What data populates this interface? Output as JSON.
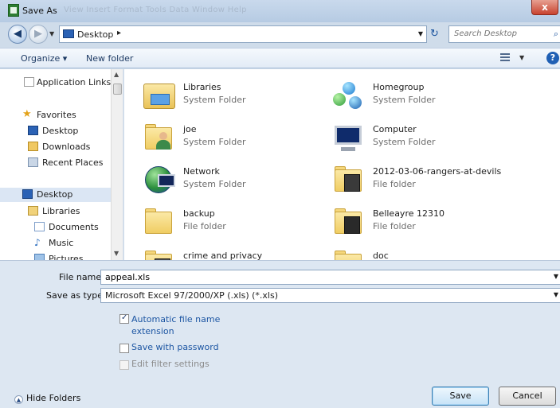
{
  "window": {
    "title": "Save As",
    "ghost_menu": "View   Insert   Format   Tools   Data   Window   Help",
    "close_glyph": "x"
  },
  "address": {
    "path": "Desktop",
    "separator": "▸",
    "search_placeholder": "Search Desktop"
  },
  "toolbar": {
    "organize": "Organize ▾",
    "new_folder": "New folder"
  },
  "navpane": {
    "items": [
      {
        "label": "Application Links",
        "icon": "document-icon"
      },
      {
        "label": "Favorites",
        "icon": "star-icon"
      },
      {
        "label": "Desktop",
        "icon": "desktop-icon"
      },
      {
        "label": "Downloads",
        "icon": "downloads-icon"
      },
      {
        "label": "Recent Places",
        "icon": "recent-places-icon"
      },
      {
        "label": "Desktop",
        "icon": "desktop-icon",
        "selected": true
      },
      {
        "label": "Libraries",
        "icon": "libraries-icon"
      },
      {
        "label": "Documents",
        "icon": "documents-icon"
      },
      {
        "label": "Music",
        "icon": "music-icon"
      },
      {
        "label": "Pictures",
        "icon": "pictures-icon"
      }
    ]
  },
  "files": [
    {
      "name": "Libraries",
      "type": "System Folder",
      "icon": "libraries-icon"
    },
    {
      "name": "Homegroup",
      "type": "System Folder",
      "icon": "homegroup-icon"
    },
    {
      "name": "joe",
      "type": "System Folder",
      "icon": "user-folder-icon"
    },
    {
      "name": "Computer",
      "type": "System Folder",
      "icon": "computer-icon"
    },
    {
      "name": "Network",
      "type": "System Folder",
      "icon": "network-icon"
    },
    {
      "name": "2012-03-06-rangers-at-devils",
      "type": "File folder",
      "icon": "photo-folder-icon"
    },
    {
      "name": "backup",
      "type": "File folder",
      "icon": "folder-icon"
    },
    {
      "name": "Belleayre 12310",
      "type": "File folder",
      "icon": "photo-folder-icon"
    },
    {
      "name": "crime and privacy",
      "type": "",
      "icon": "photo-folder-icon"
    },
    {
      "name": "doc",
      "type": "",
      "icon": "folder-icon"
    }
  ],
  "form": {
    "file_name_label": "File name:",
    "file_name_value": "appeal.xls",
    "save_as_type_label": "Save as type:",
    "save_as_type_value": "Microsoft Excel 97/2000/XP (.xls) (*.xls)",
    "auto_extension_label": "Automatic file name extension",
    "auto_extension_checked": true,
    "save_with_password_label": "Save with password",
    "save_with_password_checked": false,
    "edit_filter_label": "Edit filter settings",
    "edit_filter_checked": false,
    "hide_folders": "Hide Folders",
    "save_button": "Save",
    "cancel_button": "Cancel"
  },
  "colors": {
    "accent": "#1d56a3",
    "selection": "#dbe6f4",
    "chrome": "#cfdcea"
  }
}
